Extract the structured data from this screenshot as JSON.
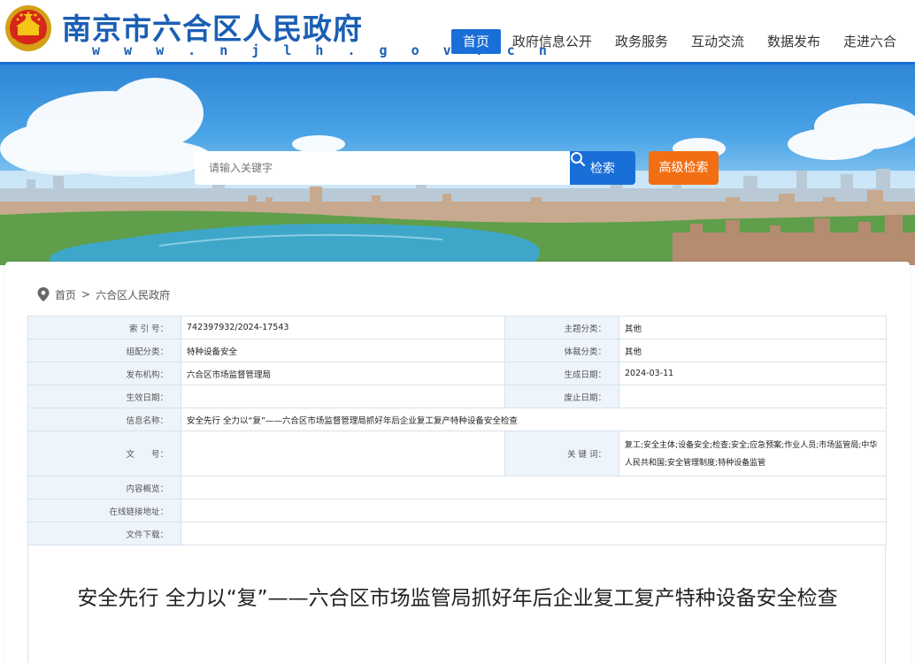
{
  "header": {
    "site_title": "南京市六合区人民政府",
    "site_url": "w w w . n j l h . g o v . c n",
    "nav": [
      {
        "label": "首页",
        "active": true
      },
      {
        "label": "政府信息公开",
        "active": false
      },
      {
        "label": "政务服务",
        "active": false
      },
      {
        "label": "互动交流",
        "active": false
      },
      {
        "label": "数据发布",
        "active": false
      },
      {
        "label": "走进六合",
        "active": false
      }
    ]
  },
  "search": {
    "placeholder": "请输入关键字",
    "search_label": "检索",
    "advanced_label": "高级检索"
  },
  "breadcrumb": {
    "home": "首页",
    "separator": ">",
    "current": "六合区人民政府"
  },
  "meta": {
    "index_key": "索 引 号：",
    "index_val": "742397932/2024-17543",
    "topic_key": "主题分类：",
    "topic_val": "其他",
    "config_key": "组配分类：",
    "config_val": "特种设备安全",
    "genre_key": "体裁分类：",
    "genre_val": "其他",
    "org_key": "发布机构：",
    "org_val": "六合区市场监督管理局",
    "gen_date_key": "生成日期：",
    "gen_date_val": "2024-03-11",
    "eff_date_key": "生效日期：",
    "eff_date_val": "",
    "abolish_key": "废止日期：",
    "abolish_val": "",
    "name_key": "信息名称：",
    "name_val": "安全先行 全力以“复”——六合区市场监督管理局抓好年后企业复工复产特种设备安全检查",
    "docno_key": "文　　号：",
    "docno_val": "",
    "keywords_key": "关 键 词：",
    "keywords_val": "复工;安全主体;设备安全;检查;安全;应急预案;作业人员;市场监管局;中华人民共和国;安全管理制度;特种设备监管",
    "summary_key": "内容概览：",
    "summary_val": "",
    "link_key": "在线链接地址：",
    "link_val": "",
    "download_key": "文件下载：",
    "download_val": ""
  },
  "article": {
    "title": "安全先行 全力以“复”——六合区市场监管局抓好年后企业复工复产特种设备安全检查"
  },
  "colors": {
    "brand_blue": "#1a6ed8",
    "title_blue": "#1a5fb4",
    "advanced_orange": "#f26e12",
    "table_key_bg": "#eef4fb"
  },
  "icons": {
    "emblem": "national-emblem-icon",
    "search": "search-icon",
    "location": "location-pin-icon"
  }
}
